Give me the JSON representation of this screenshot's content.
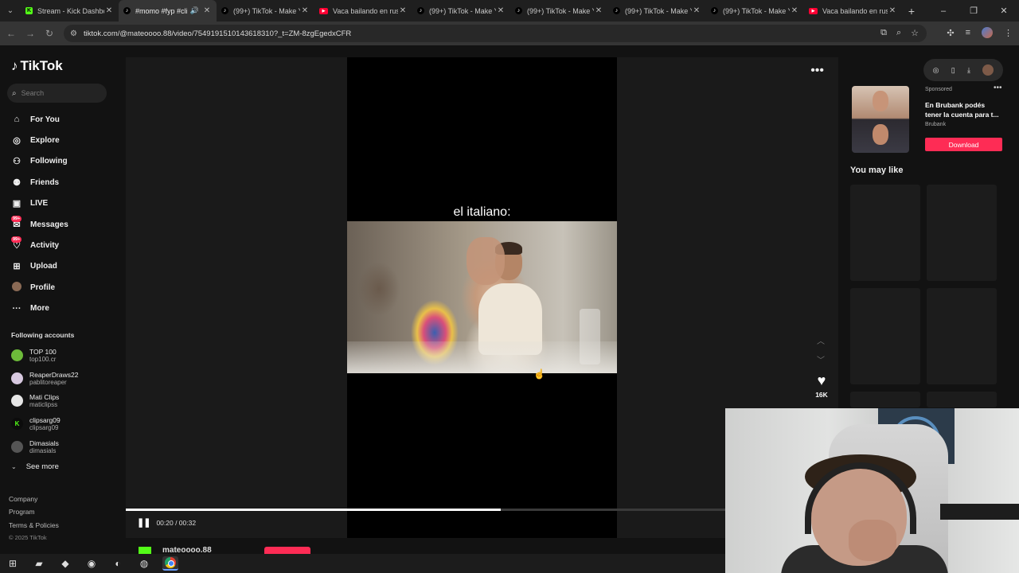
{
  "browser": {
    "tabs": [
      {
        "favicon": "kick",
        "title": "Stream - Kick Dashbo"
      },
      {
        "favicon": "tiktok",
        "title": "#momo #fyp #cli",
        "active": true,
        "audio": true
      },
      {
        "favicon": "tiktok",
        "title": "(99+) TikTok - Make Y"
      },
      {
        "favicon": "youtube",
        "title": "Vaca bailando en rus"
      },
      {
        "favicon": "tiktok",
        "title": "(99+) TikTok - Make Y"
      },
      {
        "favicon": "tiktok",
        "title": "(99+) TikTok - Make Y"
      },
      {
        "favicon": "tiktok",
        "title": "(99+) TikTok - Make Y"
      },
      {
        "favicon": "tiktok",
        "title": "(99+) TikTok - Make Y"
      },
      {
        "favicon": "youtube",
        "title": "Vaca bailando en rus"
      }
    ],
    "url": "tiktok.com/@mateoooo.88/video/7549191510143618310?_t=ZM-8zgEgedxCFR"
  },
  "sidebar": {
    "logo": "TikTok",
    "search_placeholder": "Search",
    "nav": [
      {
        "label": "For You",
        "icon": "home-icon"
      },
      {
        "label": "Explore",
        "icon": "compass-icon"
      },
      {
        "label": "Following",
        "icon": "following-icon"
      },
      {
        "label": "Friends",
        "icon": "friends-icon"
      },
      {
        "label": "LIVE",
        "icon": "live-icon"
      },
      {
        "label": "Messages",
        "icon": "messages-icon",
        "badge": "99+"
      },
      {
        "label": "Activity",
        "icon": "activity-icon",
        "badge": "99+"
      },
      {
        "label": "Upload",
        "icon": "upload-icon"
      },
      {
        "label": "Profile",
        "icon": "profile-avatar"
      },
      {
        "label": "More",
        "icon": "more-icon"
      }
    ],
    "following_title": "Following accounts",
    "following": [
      {
        "name": "TOP 100",
        "user": "top100.cr",
        "color": "#6dbb3a"
      },
      {
        "name": "ReaperDraws22",
        "user": "pablitoreaper",
        "color": "#d8c9e0"
      },
      {
        "name": "Mati Clips",
        "user": "maticlipss",
        "color": "#e6e6e6"
      },
      {
        "name": "clipsarg09",
        "user": "clipsarg09",
        "color": "#0c0c0c"
      },
      {
        "name": "Dimasials",
        "user": "dimasials",
        "color": "#555555"
      }
    ],
    "see_more": "See more",
    "footer": [
      "Company",
      "Program",
      "Terms & Policies"
    ],
    "copyright": "© 2025 TikTok"
  },
  "video": {
    "caption_overlay": "el italiano:",
    "likes": "16K",
    "time": "00:20 / 00:32",
    "progress": 0.625,
    "author": "mateoooo.88"
  },
  "ad": {
    "label": "Sponsored",
    "title": "En Brubank podés tener la cuenta para t...",
    "brand": "Brubank",
    "cta": "Download"
  },
  "you_may_like": "You may like",
  "colors": {
    "accent": "#fe2c55",
    "kick": "#53fc18"
  }
}
